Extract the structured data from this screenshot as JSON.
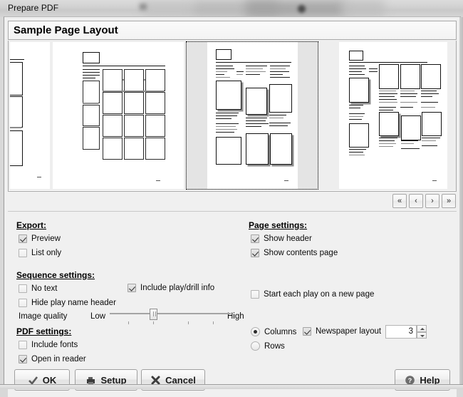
{
  "window": {
    "title": "Prepare PDF"
  },
  "header": {
    "title": "Sample Page Layout"
  },
  "carousel": {
    "nav": [
      {
        "name": "first",
        "label": "«"
      },
      {
        "name": "prev",
        "label": "‹"
      },
      {
        "name": "next",
        "label": "›"
      },
      {
        "name": "last",
        "label": "»"
      }
    ],
    "thumbnails": [
      {
        "name": "layout-partial-left",
        "selected": false
      },
      {
        "name": "layout-grid",
        "selected": false
      },
      {
        "name": "layout-newspaper",
        "selected": true
      },
      {
        "name": "layout-mixed",
        "selected": false
      }
    ]
  },
  "settings": {
    "export": {
      "title": "Export:",
      "preview": {
        "label": "Preview",
        "checked": true
      },
      "list_only": {
        "label": "List only",
        "checked": false
      }
    },
    "sequence": {
      "title": "Sequence settings:",
      "no_text": {
        "label": "No text",
        "checked": false
      },
      "include_play_info": {
        "label": "Include play/drill info",
        "checked": true
      },
      "hide_play_header": {
        "label": "Hide play name header",
        "checked": false
      },
      "image_quality": {
        "label": "Image quality",
        "low_label": "Low",
        "high_label": "High",
        "value": 33
      }
    },
    "pdf": {
      "title": "PDF settings:",
      "include_fonts": {
        "label": "Include fonts",
        "checked": false
      },
      "open_in_reader": {
        "label": "Open in reader",
        "checked": true
      }
    },
    "page": {
      "title": "Page settings:",
      "show_header": {
        "label": "Show header",
        "checked": true
      },
      "show_contents_page": {
        "label": "Show contents page",
        "checked": true
      },
      "start_each_play": {
        "label": "Start each play on a new page",
        "checked": false
      },
      "orientation": {
        "columns": {
          "label": "Columns",
          "selected": true
        },
        "rows": {
          "label": "Rows",
          "selected": false
        }
      },
      "newspaper_layout": {
        "label": "Newspaper layout",
        "checked": true
      },
      "count": {
        "value": "3"
      }
    }
  },
  "buttons": {
    "ok": {
      "label": "OK"
    },
    "setup": {
      "label": "Setup"
    },
    "cancel": {
      "label": "Cancel"
    },
    "help": {
      "label": "Help"
    }
  }
}
